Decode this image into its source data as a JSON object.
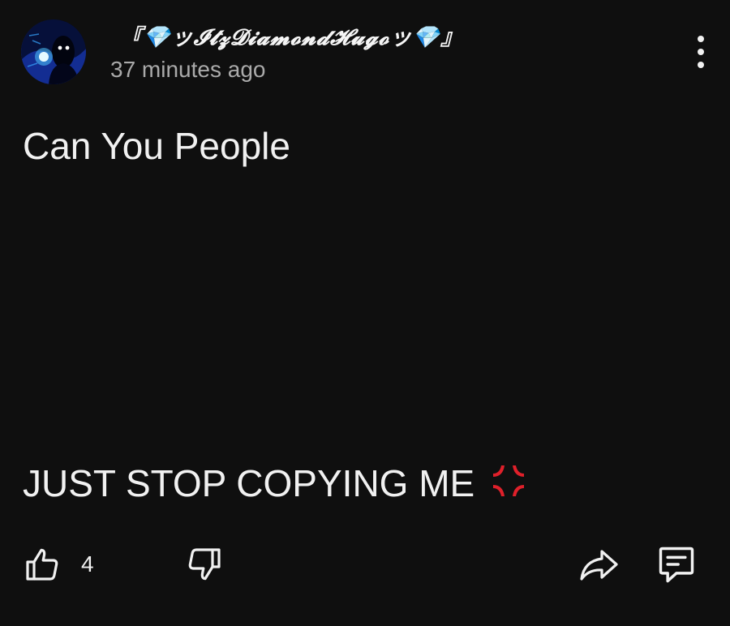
{
  "post": {
    "author": "『💎ッ𝓘𝓽𝔃𝓓𝓲𝓪𝓶𝓸𝓷𝓭𝓗𝓾𝓰𝓸ッ💎』",
    "timestamp": "37 minutes ago",
    "text_line1": "Can You People",
    "text_line2": "JUST STOP COPYING ME",
    "anger_emoji_icon": "anger-symbol-icon"
  },
  "actions": {
    "like_count": "4",
    "like_icon": "thumbs-up-icon",
    "dislike_icon": "thumbs-down-icon",
    "share_icon": "share-icon",
    "comment_icon": "comment-icon"
  },
  "colors": {
    "background": "#0f0f0f",
    "text": "#f1f1f1",
    "secondary_text": "#aaaaaa",
    "anger_emoji": "#e0202a"
  }
}
